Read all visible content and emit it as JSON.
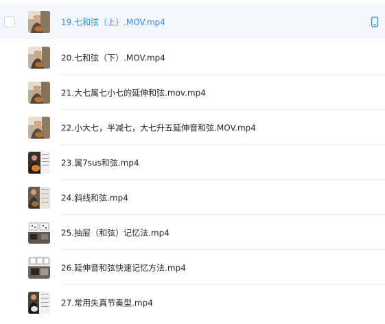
{
  "files": [
    {
      "name": "19.七和弦（上）.MOV.mp4",
      "thumb_icon": "video-thumbnail-man-guitar-icon"
    },
    {
      "name": "20.七和弦（下）.MOV.mp4",
      "thumb_icon": "video-thumbnail-man-guitar-icon"
    },
    {
      "name": "21.大七属七小七的延伸和弦.mov.mp4",
      "thumb_icon": "video-thumbnail-man-guitar-icon"
    },
    {
      "name": "22.小大七，半减七，大七升五延伸音和弦.MOV.mp4",
      "thumb_icon": "video-thumbnail-man-guitar-icon"
    },
    {
      "name": "23.属7sus和弦.mp4",
      "thumb_icon": "video-thumbnail-guitar-diagram-icon"
    },
    {
      "name": "24.斜线和弦.mp4",
      "thumb_icon": "video-thumbnail-guitar-diagram-icon"
    },
    {
      "name": "25.抽屉（和弦）记忆法.mp4",
      "thumb_icon": "video-thumbnail-chord-chart-icon"
    },
    {
      "name": "26.延伸音和弦快速记忆方法.mp4",
      "thumb_icon": "video-thumbnail-chord-chart-icon"
    },
    {
      "name": "27.常用失真节奏型.mp4",
      "thumb_icon": "video-thumbnail-guitar-diagram-icon"
    }
  ],
  "selected_index": 0,
  "selected_action_icon": "mobile-device-icon",
  "colors": {
    "selected_text": "#2e8cf0",
    "selected_bg": "#f4f6fb",
    "text": "#1f2329",
    "divider": "#eef0f4"
  }
}
